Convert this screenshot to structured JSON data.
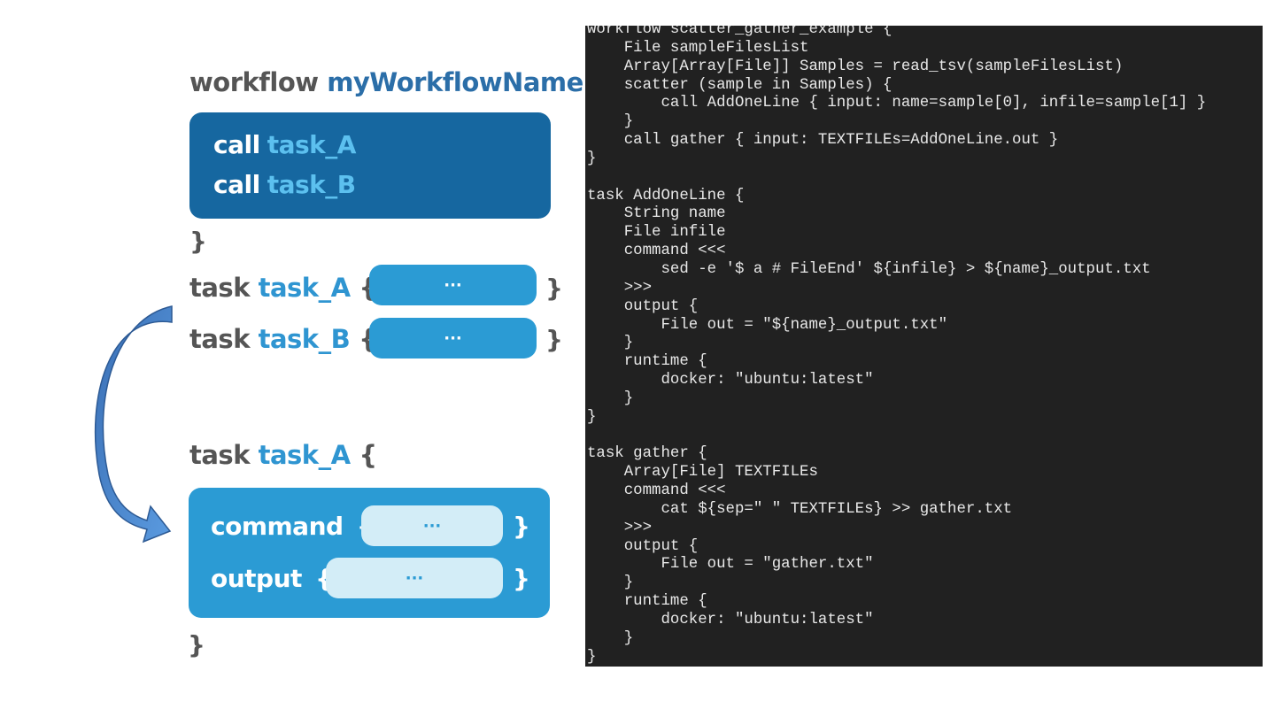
{
  "left_diagram": {
    "workflow_keyword": "workflow",
    "workflow_name": "myWorkflowName",
    "open_brace": "{",
    "close_brace": "}",
    "calls": [
      {
        "keyword": "call",
        "task": "task_A"
      },
      {
        "keyword": "call",
        "task": "task_B"
      }
    ],
    "task_rows": [
      {
        "keyword": "task",
        "name": "task_A",
        "open": "{",
        "body": "···",
        "close": "}"
      },
      {
        "keyword": "task",
        "name": "task_B",
        "open": "{",
        "body": "···",
        "close": "}"
      }
    ],
    "detail": {
      "keyword": "task",
      "name": "task_A",
      "open": "{",
      "command_label": "command",
      "command_open": "{",
      "command_body": "···",
      "command_close": "}",
      "output_label": "output",
      "output_open": "{",
      "output_body": "···",
      "output_close": "}",
      "close": "}"
    }
  },
  "code": {
    "lines": [
      "workflow scatter_gather_example {",
      "    File sampleFilesList",
      "    Array[Array[File]] Samples = read_tsv(sampleFilesList)",
      "    scatter (sample in Samples) {",
      "        call AddOneLine { input: name=sample[0], infile=sample[1] }",
      "    }",
      "    call gather { input: TEXTFILEs=AddOneLine.out }",
      "}",
      "",
      "task AddOneLine {",
      "    String name",
      "    File infile",
      "    command <<<",
      "        sed -e '$ a # FileEnd' ${infile} > ${name}_output.txt",
      "    >>>",
      "    output {",
      "        File out = \"${name}_output.txt\"",
      "    }",
      "    runtime {",
      "        docker: \"ubuntu:latest\"",
      "    }",
      "}",
      "",
      "task gather {",
      "    Array[File] TEXTFILEs",
      "    command <<<",
      "        cat ${sep=\" \" TEXTFILEs} >> gather.txt",
      "    >>>",
      "    output {",
      "        File out = \"gather.txt\"",
      "    }",
      "    runtime {",
      "        docker: \"ubuntu:latest\"",
      "    }",
      "}"
    ]
  },
  "colors": {
    "dark_panel": "#1667a0",
    "light_panel": "#2b9bd4",
    "inner_pill": "#d3edf7",
    "keyword_gray": "#555555",
    "code_bg": "#212121"
  }
}
